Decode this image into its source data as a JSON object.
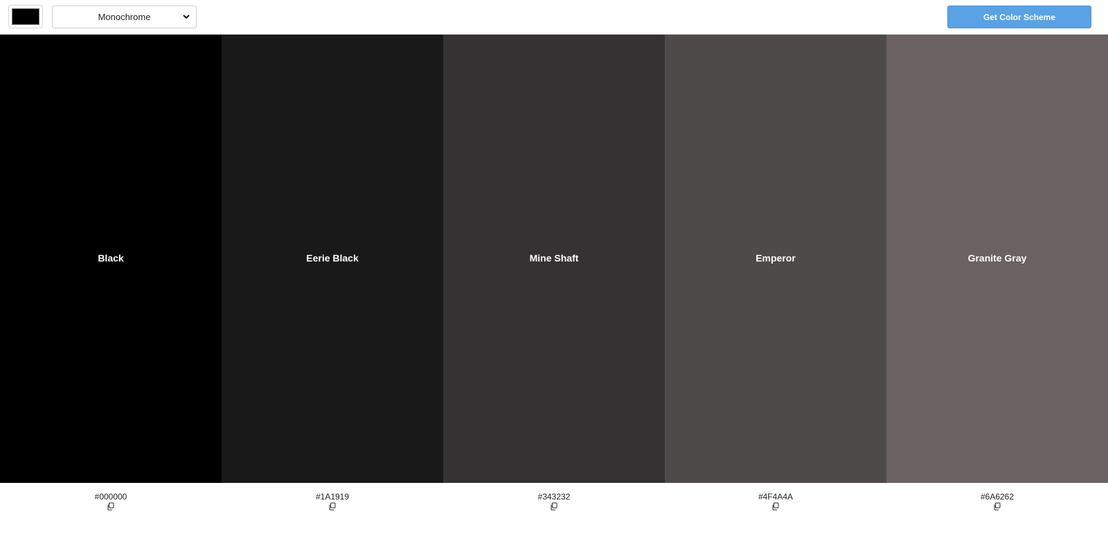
{
  "toolbar": {
    "picker_color": "#000000",
    "mode_selected": "Monochrome",
    "get_button_label": "Get Color Scheme",
    "accent": "#5aa2e6"
  },
  "palette": [
    {
      "name": "Black",
      "hex": "#000000"
    },
    {
      "name": "Eerie Black",
      "hex": "#1A1919"
    },
    {
      "name": "Mine Shaft",
      "hex": "#343232"
    },
    {
      "name": "Emperor",
      "hex": "#4F4A4A"
    },
    {
      "name": "Granite Gray",
      "hex": "#6A6262"
    }
  ],
  "icons": {
    "copy": "copy-icon",
    "dropdown": "chevron-down-icon"
  }
}
